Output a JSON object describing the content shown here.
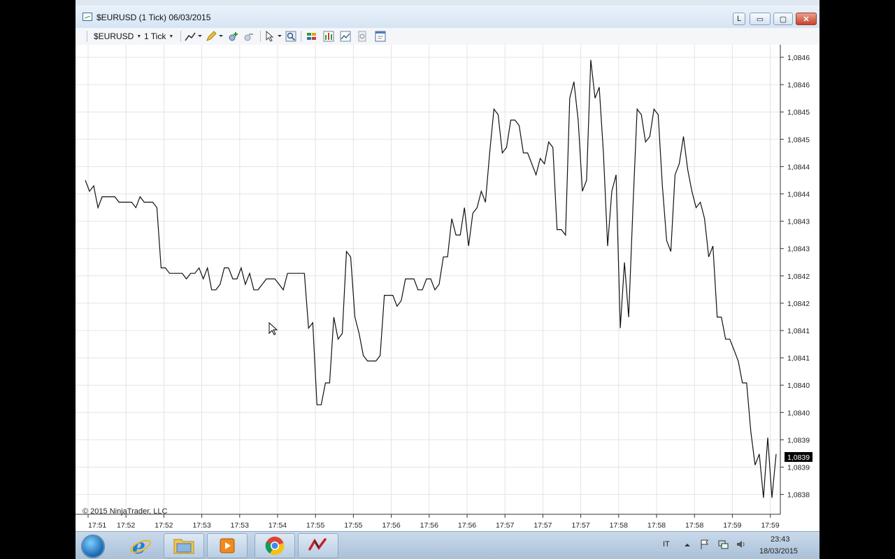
{
  "window": {
    "title": "$EURUSD (1 Tick)  06/03/2015",
    "buttons": {
      "layout": "L",
      "minimize": "▭",
      "maximize": "▢",
      "close": "✕"
    }
  },
  "toolbar": {
    "instrument": "$EURUSD",
    "interval": "1 Tick"
  },
  "chart": {
    "copyright": "© 2015 NinjaTrader, LLC",
    "last_price": "1,0839",
    "line_color": "#111111",
    "grid_color": "#e4e4e4"
  },
  "chart_data": {
    "type": "line",
    "y_ticks": [
      "1,0846",
      "1,0846",
      "1,0845",
      "1,0845",
      "1,0844",
      "1,0844",
      "1,0843",
      "1,0843",
      "1,0842",
      "1,0842",
      "1,0841",
      "1,0841",
      "1,0840",
      "1,0840",
      "1,0839",
      "1,0839",
      "1,0838"
    ],
    "x_ticks": [
      "17:51",
      "17:52",
      "17:52",
      "17:53",
      "17:53",
      "17:54",
      "17:55",
      "17:55",
      "17:56",
      "17:56",
      "17:56",
      "17:57",
      "17:57",
      "17:57",
      "17:58",
      "17:58",
      "17:58",
      "17:59",
      "17:59"
    ],
    "ylim": [
      1.08377,
      1.08462
    ],
    "series": [
      {
        "values": [
          1.08438,
          1.08436,
          1.08437,
          1.08433,
          1.08435,
          1.08435,
          1.08435,
          1.08435,
          1.08434,
          1.08434,
          1.08434,
          1.08434,
          1.08433,
          1.08435,
          1.08434,
          1.08434,
          1.08434,
          1.08433,
          1.08422,
          1.08422,
          1.08421,
          1.08421,
          1.08421,
          1.08421,
          1.0842,
          1.08421,
          1.08421,
          1.08422,
          1.0842,
          1.08422,
          1.08418,
          1.08418,
          1.08419,
          1.08422,
          1.08422,
          1.0842,
          1.0842,
          1.08422,
          1.08419,
          1.08421,
          1.08418,
          1.08418,
          1.08419,
          1.0842,
          1.0842,
          1.0842,
          1.08419,
          1.08418,
          1.08421,
          1.08421,
          1.08421,
          1.08421,
          1.08421,
          1.08411,
          1.08412,
          1.08397,
          1.08397,
          1.08401,
          1.08401,
          1.08413,
          1.08409,
          1.0841,
          1.08425,
          1.08424,
          1.08413,
          1.0841,
          1.08406,
          1.08405,
          1.08405,
          1.08405,
          1.08406,
          1.08417,
          1.08417,
          1.08417,
          1.08415,
          1.08416,
          1.0842,
          1.0842,
          1.0842,
          1.08418,
          1.08418,
          1.0842,
          1.0842,
          1.08418,
          1.08419,
          1.08424,
          1.08424,
          1.08431,
          1.08428,
          1.08428,
          1.08433,
          1.08426,
          1.08432,
          1.08433,
          1.08436,
          1.08434,
          1.08443,
          1.08451,
          1.0845,
          1.08443,
          1.08444,
          1.08449,
          1.08449,
          1.08448,
          1.08443,
          1.08443,
          1.08441,
          1.08439,
          1.08442,
          1.08441,
          1.08445,
          1.08444,
          1.08429,
          1.08429,
          1.08428,
          1.08453,
          1.08456,
          1.08449,
          1.08436,
          1.08438,
          1.0846,
          1.08453,
          1.08455,
          1.08443,
          1.08426,
          1.08436,
          1.08439,
          1.08411,
          1.08423,
          1.08413,
          1.08433,
          1.08451,
          1.0845,
          1.08445,
          1.08446,
          1.08451,
          1.0845,
          1.08437,
          1.08427,
          1.08425,
          1.08439,
          1.08441,
          1.08446,
          1.0844,
          1.08436,
          1.08433,
          1.08434,
          1.08431,
          1.08424,
          1.08426,
          1.08413,
          1.08413,
          1.08409,
          1.08409,
          1.08407,
          1.08405,
          1.08401,
          1.08401,
          1.08392,
          1.08386,
          1.08388,
          1.0838,
          1.08391,
          1.0838,
          1.08388
        ]
      }
    ]
  },
  "taskbar": {
    "apps": [
      "start-menu",
      "internet-explorer",
      "file-explorer",
      "media-player",
      "chrome",
      "ninjatrader"
    ],
    "language": "IT",
    "time": "23:43",
    "date": "18/03/2015"
  }
}
